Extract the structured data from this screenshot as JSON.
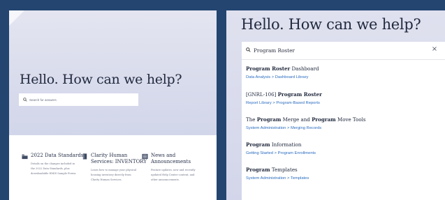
{
  "left": {
    "title": "Hello. How can we help?",
    "search_placeholder": "Search for answers",
    "categories": [
      {
        "icon": "folder-icon",
        "title": "2022 Data Standards",
        "desc": [
          "Details on the changes included in",
          "the 2022 Data Standards, plus",
          "downloadable HMIS Sample Forms"
        ]
      },
      {
        "icon": "book-icon",
        "title": "Clarity Human Services: INVENTORY",
        "desc": [
          "Learn how to manage your physical",
          "housing inventory directly from",
          "Clarity Human Services."
        ]
      },
      {
        "icon": "news-icon",
        "title": "News and Announcements",
        "desc": [
          "Feature updates, new and recently",
          "updated Help Center content, and",
          "other announcements."
        ]
      }
    ]
  },
  "right": {
    "title": "Hello. How can we help?",
    "search_value": "Program Roster",
    "close_label": "×",
    "results": [
      {
        "title_parts": [
          {
            "text": "Program Roster",
            "bold": true
          },
          {
            "text": " Dashboard",
            "bold": false
          }
        ],
        "crumbs": [
          "Data Analysis",
          "Dashboard Library"
        ]
      },
      {
        "title_parts": [
          {
            "text": "[GNRL-106] ",
            "bold": false
          },
          {
            "text": "Program Roster",
            "bold": true
          }
        ],
        "crumbs": [
          "Report Library",
          "Program-Based Reports"
        ]
      },
      {
        "title_parts": [
          {
            "text": "The ",
            "bold": false
          },
          {
            "text": "Program",
            "bold": true
          },
          {
            "text": " Merge and ",
            "bold": false
          },
          {
            "text": "Program",
            "bold": true
          },
          {
            "text": " Move Tools",
            "bold": false
          }
        ],
        "crumbs": [
          "System Administration",
          "Merging Records"
        ]
      },
      {
        "title_parts": [
          {
            "text": "Program",
            "bold": true
          },
          {
            "text": " Information",
            "bold": false
          }
        ],
        "crumbs": [
          "Getting Started",
          "Program Enrollments"
        ]
      },
      {
        "title_parts": [
          {
            "text": "Program",
            "bold": true
          },
          {
            "text": " Templates",
            "bold": false
          }
        ],
        "crumbs": [
          "System Administration",
          "Templates"
        ]
      }
    ],
    "crumb_separator": ">"
  },
  "colors": {
    "frame": "#234570",
    "link": "#2a6cc0",
    "heading": "#222a3e"
  }
}
